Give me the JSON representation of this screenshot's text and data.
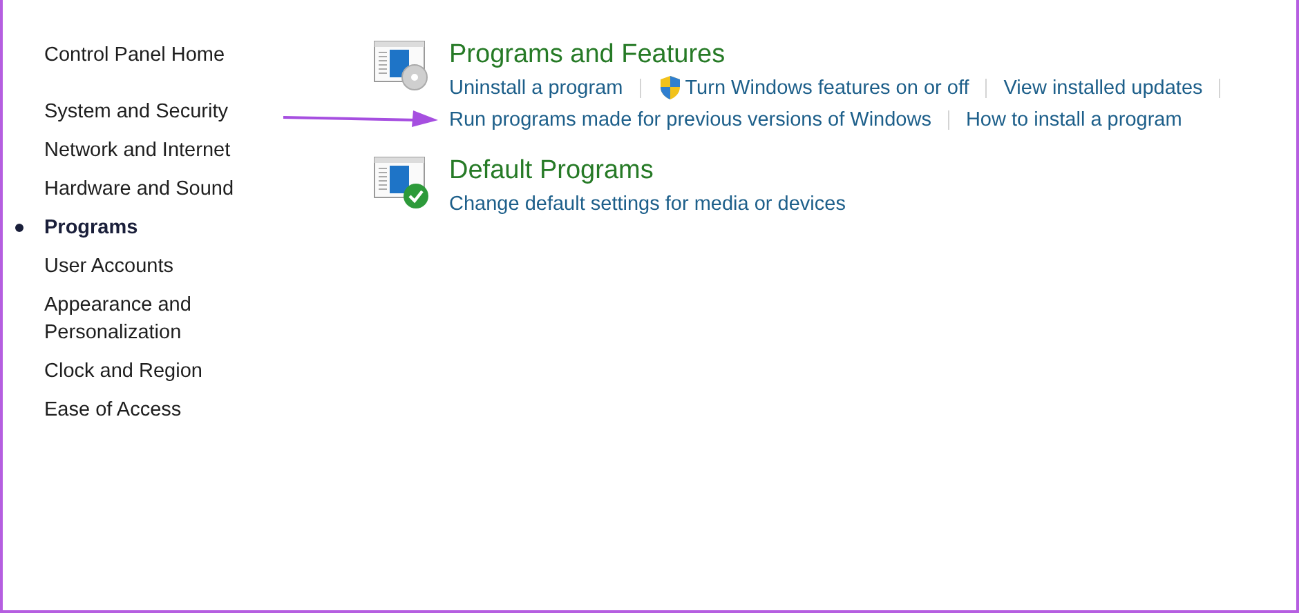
{
  "sidebar": {
    "home": "Control Panel Home",
    "items": [
      {
        "label": "System and Security",
        "selected": false
      },
      {
        "label": "Network and Internet",
        "selected": false
      },
      {
        "label": "Hardware and Sound",
        "selected": false
      },
      {
        "label": "Programs",
        "selected": true
      },
      {
        "label": "User Accounts",
        "selected": false
      },
      {
        "label": "Appearance and Personalization",
        "selected": false
      },
      {
        "label": "Clock and Region",
        "selected": false
      },
      {
        "label": "Ease of Access",
        "selected": false
      }
    ]
  },
  "sections": [
    {
      "kind": "features",
      "title": "Programs and Features",
      "link_rows": [
        {
          "trailing_separator": true,
          "links": [
            {
              "label": "Uninstall a program",
              "kind": "plain"
            },
            {
              "label": "Turn Windows features on or off",
              "kind": "shield"
            },
            {
              "label": "View installed updates",
              "kind": "plain"
            }
          ]
        },
        {
          "trailing_separator": false,
          "arrow": true,
          "links": [
            {
              "label": "Run programs made for previous versions of Windows",
              "kind": "plain"
            },
            {
              "label": "How to install a program",
              "kind": "plain"
            }
          ]
        }
      ]
    },
    {
      "kind": "defaults",
      "title": "Default Programs",
      "link_rows": [
        {
          "trailing_separator": false,
          "links": [
            {
              "label": "Change default settings for media or devices",
              "kind": "plain"
            }
          ]
        }
      ]
    }
  ]
}
